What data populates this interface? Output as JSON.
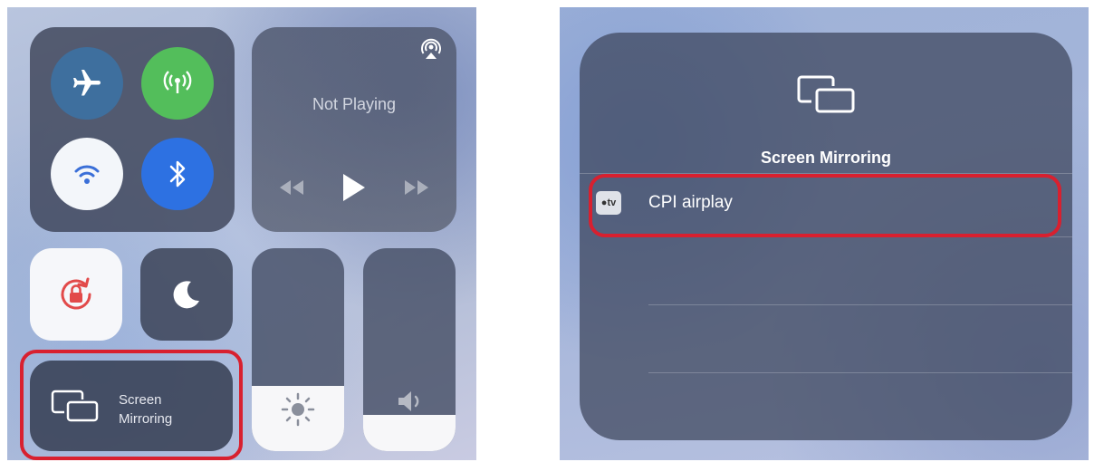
{
  "left_panel": {
    "connectivity": {
      "airplane": {
        "icon": "airplane-icon"
      },
      "cellular": {
        "icon": "cellular-antenna-icon"
      },
      "wifi": {
        "icon": "wifi-icon"
      },
      "bluetooth": {
        "icon": "bluetooth-icon"
      }
    },
    "media": {
      "title": "Not Playing",
      "airplay_icon": "airplay-icon",
      "controls": [
        "rewind-icon",
        "play-icon",
        "fast-forward-icon"
      ]
    },
    "orientation_lock": {
      "icon": "orientation-lock-icon"
    },
    "do_not_disturb": {
      "icon": "moon-icon"
    },
    "screen_mirroring": {
      "line1": "Screen",
      "line2": "Mirroring",
      "icon": "screen-mirroring-icon"
    },
    "brightness": {
      "level": 0.32,
      "icon": "sun-icon"
    },
    "volume": {
      "level": 0.18,
      "icon": "speaker-icon"
    }
  },
  "right_panel": {
    "title": "Screen Mirroring",
    "icon": "screen-mirroring-icon",
    "devices": [
      {
        "badge": "tv",
        "name": "CPI airplay"
      }
    ]
  },
  "colors": {
    "highlight": "#d8202f",
    "cellular_green": "#53be5b",
    "bluetooth_blue": "#2d71e2",
    "airplane_blue": "#3e6f9e"
  }
}
